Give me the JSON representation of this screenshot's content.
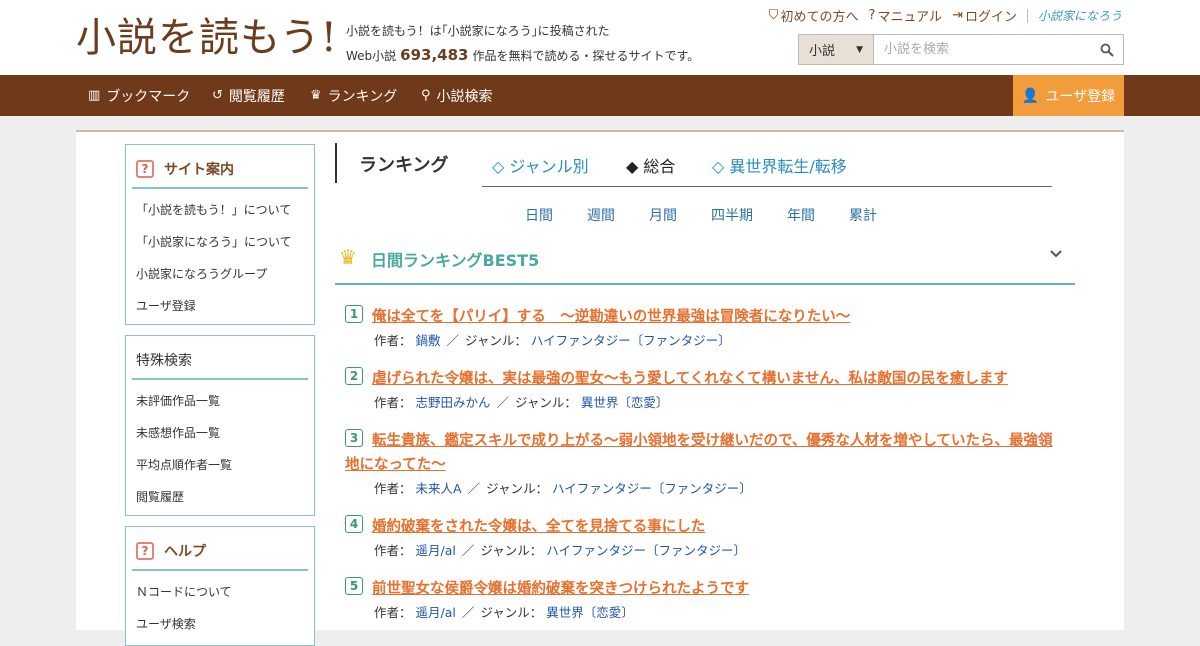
{
  "header": {
    "logo": "小説を読もう!",
    "tagline_line1": "小説を読もう！は｢小説家になろう｣に投稿された",
    "tagline_prefix": "Web小説",
    "work_count": "693,483",
    "tagline_suffix": "作品を無料で読める・探せるサイトです。",
    "links": [
      {
        "label": "初めての方へ",
        "icon": "shield-icon"
      },
      {
        "label": "マニュアル",
        "icon": "question-circle-icon"
      },
      {
        "label": "ログイン",
        "icon": "login-icon"
      }
    ],
    "brand": "小説家になろう"
  },
  "search": {
    "category": "小説",
    "placeholder": "小説を検索"
  },
  "nav": {
    "items": [
      {
        "label": "ブックマーク",
        "icon": "bookmark-icon"
      },
      {
        "label": "閲覧履歴",
        "icon": "history-icon"
      },
      {
        "label": "ランキング",
        "icon": "crown-icon"
      },
      {
        "label": "小説検索",
        "icon": "search-icon"
      }
    ],
    "register": "ユーザ登録"
  },
  "sidebar": {
    "site_guide": {
      "title": "サイト案内",
      "items": [
        "「小説を読もう！」について",
        "「小説家になろう」について",
        "小説家になろうグループ",
        "ユーザ登録"
      ]
    },
    "special_search": {
      "title": "特殊検索",
      "items": [
        "未評価作品一覧",
        "未感想作品一覧",
        "平均点順作者一覧",
        "閲覧履歴"
      ]
    },
    "help": {
      "title": "ヘルプ",
      "items": [
        "Ｎコードについて",
        "ユーザ検索"
      ]
    }
  },
  "ranking": {
    "title": "ランキング",
    "tabs": [
      "◇ ジャンル別",
      "◆ 総合",
      "◇ 異世界転生/転移"
    ],
    "active_tab": "◆ 総合",
    "periods": [
      "日間",
      "週間",
      "月間",
      "四半期",
      "年間",
      "累計"
    ],
    "section_title": "日間ランキングBEST5",
    "author_label": "作者：",
    "genre_label": "ジャンル：",
    "entries": [
      {
        "rank": "1",
        "title": "俺は全てを【パリイ】する　〜逆勘違いの世界最強は冒険者になりたい〜",
        "author": "鍋敷",
        "genre": "ハイファンタジー〔ファンタジー〕"
      },
      {
        "rank": "2",
        "title": "虐げられた令嬢は、実は最強の聖女～もう愛してくれなくて構いません、私は敵国の民を癒します",
        "author": "志野田みかん",
        "genre": "異世界〔恋愛〕"
      },
      {
        "rank": "3",
        "title": "転生貴族、鑑定スキルで成り上がる～弱小領地を受け継いだので、優秀な人材を増やしていたら、最強領地になってた～",
        "author": "未来人A",
        "genre": "ハイファンタジー〔ファンタジー〕"
      },
      {
        "rank": "4",
        "title": "婚約破棄をされた令嬢は、全てを見捨てる事にした",
        "author": "遥月/al",
        "genre": "ハイファンタジー〔ファンタジー〕"
      },
      {
        "rank": "5",
        "title": "前世聖女な侯爵令嬢は婚約破棄を突きつけられたようです",
        "author": "遥月/al",
        "genre": "異世界〔恋愛〕"
      }
    ]
  }
}
